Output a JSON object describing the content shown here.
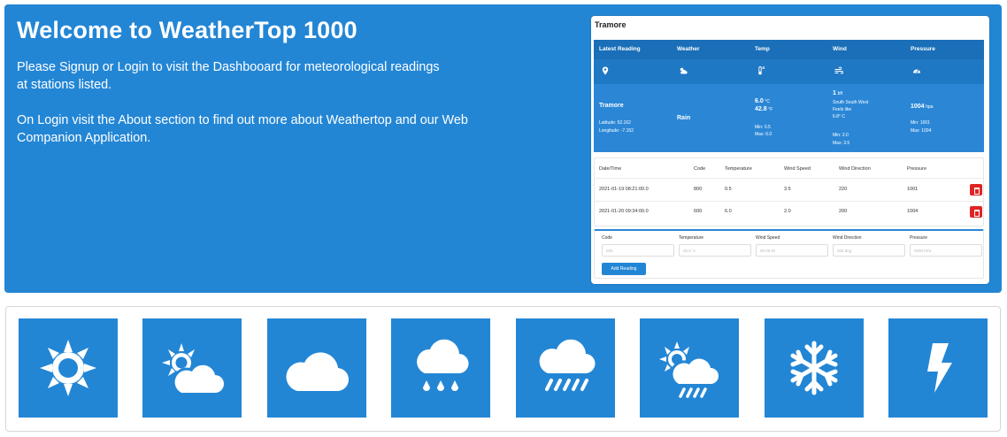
{
  "hero": {
    "title": "Welcome to WeatherTop 1000",
    "paragraph_1": "Please Signup or Login to visit the Dashbooard for meteorological readings at stations listed.",
    "paragraph_2": "On Login visit the About section to find out more about Weathertop and our Web Companion Application."
  },
  "preview": {
    "station": "Tramore",
    "summary_headers": [
      "Latest Reading",
      "Weather",
      "Temp",
      "Wind",
      "Pressure"
    ],
    "summary_icons": [
      "map-marker-icon",
      "cloud-sun-icon",
      "thermometer-icon",
      "wind-icon",
      "gauge-icon"
    ],
    "latest": {
      "name": "Tramore",
      "latitude": "Latitude: 52.162",
      "longitude": "Longitude: -7.152"
    },
    "weather": "Rain",
    "temp": {
      "c": "6.0",
      "c_unit": "°C",
      "f": "42.8",
      "f_unit": "°F",
      "min": "Min: 0.5",
      "max": "Max: 6.0"
    },
    "wind": {
      "bft": "1",
      "bft_unit": "bft",
      "direction": "South South West",
      "feels_label": "Feels like",
      "feels_value": "6.8° C",
      "min": "Min: 2.0",
      "max": "Max: 3.5"
    },
    "pressure": {
      "value": "1004",
      "unit": "hpa",
      "min": "Min: 1001",
      "max": "Max: 1004"
    },
    "table": {
      "headers": [
        "Date/Time",
        "Code",
        "Temperature",
        "Wind Speed",
        "Wind Direction",
        "Pressure"
      ],
      "rows": [
        [
          "2021-01-19 08:21:00.0",
          "800",
          "0.5",
          "3.5",
          "220",
          "1001"
        ],
        [
          "2021-01-20 09:34:00.0",
          "600",
          "6.0",
          "2.0",
          "200",
          "1004"
        ]
      ]
    },
    "form": {
      "labels": [
        "Code",
        "Temperature",
        "Wind Speed",
        "Wind Direction",
        "Pressure"
      ],
      "placeholders": [
        "000",
        "00.0 °c",
        "00.00 kh",
        "000 deg",
        "0000 hPa"
      ],
      "button": "Add Reading"
    }
  },
  "tiles": [
    {
      "icon": "sun-icon"
    },
    {
      "icon": "partly-cloudy-icon"
    },
    {
      "icon": "cloud-icon"
    },
    {
      "icon": "showers-icon"
    },
    {
      "icon": "rain-icon"
    },
    {
      "icon": "sun-showers-icon"
    },
    {
      "icon": "snowflake-icon"
    },
    {
      "icon": "lightning-icon"
    }
  ],
  "colors": {
    "brand_blue": "#2386d5",
    "delete_red": "#e02424"
  }
}
